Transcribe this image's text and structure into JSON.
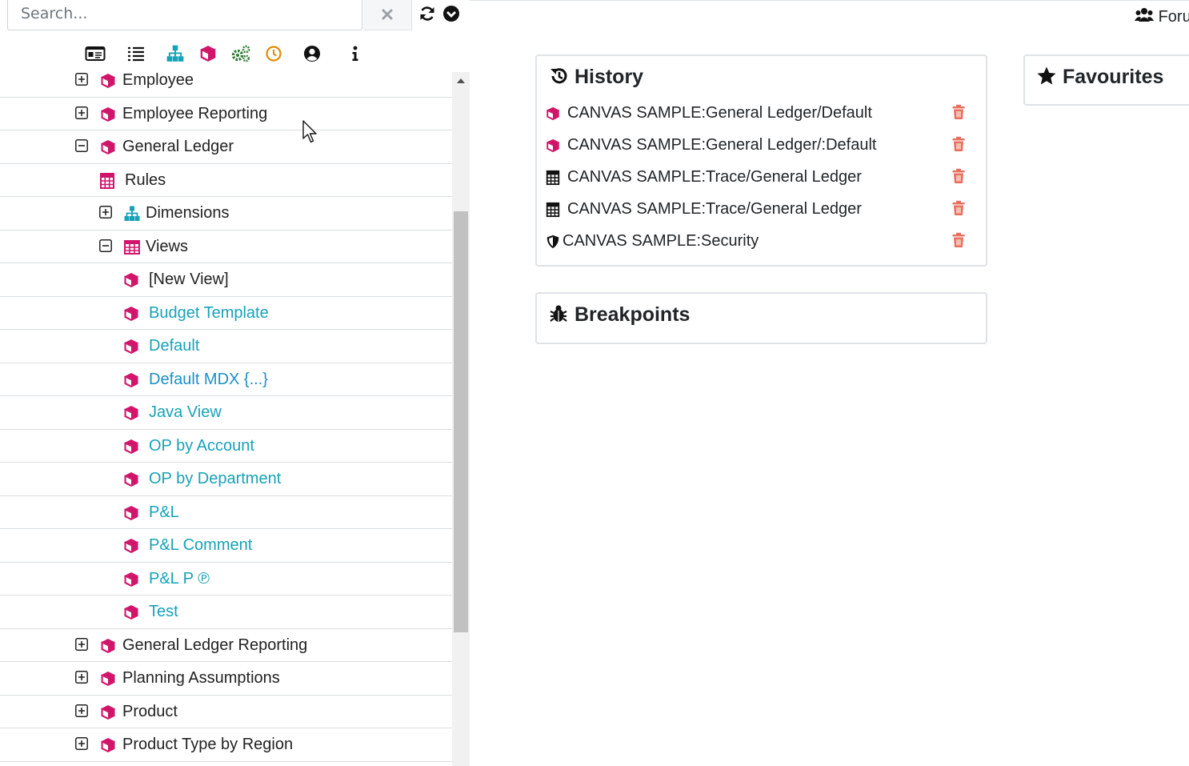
{
  "search": {
    "placeholder": "Search..."
  },
  "colors": {
    "cube": "#d1156b",
    "link": "#17a2b8",
    "link_alt": "#1a8fc7",
    "trash": "#e8705e",
    "hierarchy": "#17a2b8",
    "gears": "#2e7d32",
    "clock": "#e08a00"
  },
  "toolbar_icons": [
    "id-card-icon",
    "list-icon",
    "hierarchy-icon",
    "cube-icon",
    "gears-icon",
    "clock-icon",
    "user-circle-icon",
    "info-icon"
  ],
  "tree": [
    {
      "label": "Employee",
      "level": 0,
      "toggle": "plus",
      "icon": "cube",
      "style": "dark"
    },
    {
      "label": "Employee Reporting",
      "level": 0,
      "toggle": "plus",
      "icon": "cube",
      "style": "dark"
    },
    {
      "label": "General Ledger",
      "level": 0,
      "toggle": "minus",
      "icon": "cube",
      "style": "dark"
    },
    {
      "label": "Rules",
      "level": 1,
      "toggle": "none",
      "icon": "calculator",
      "style": "dark"
    },
    {
      "label": "Dimensions",
      "level": 1,
      "toggle": "plus",
      "icon": "hierarchy",
      "style": "dark"
    },
    {
      "label": "Views",
      "level": 1,
      "toggle": "minus",
      "icon": "table",
      "style": "dark"
    },
    {
      "label": "[New View]",
      "level": 2,
      "toggle": "none",
      "icon": "cube",
      "style": "dark"
    },
    {
      "label": "Budget Template",
      "level": 2,
      "toggle": "none",
      "icon": "cube",
      "style": "link"
    },
    {
      "label": "Default",
      "level": 2,
      "toggle": "none",
      "icon": "cube",
      "style": "link"
    },
    {
      "label": "Default MDX {...}",
      "level": 2,
      "toggle": "none",
      "icon": "cube",
      "style": "link2"
    },
    {
      "label": "Java View",
      "level": 2,
      "toggle": "none",
      "icon": "cube",
      "style": "link"
    },
    {
      "label": "OP by Account",
      "level": 2,
      "toggle": "none",
      "icon": "cube",
      "style": "link"
    },
    {
      "label": "OP by Department",
      "level": 2,
      "toggle": "none",
      "icon": "cube",
      "style": "link"
    },
    {
      "label": "P&L",
      "level": 2,
      "toggle": "none",
      "icon": "cube",
      "style": "link"
    },
    {
      "label": "P&L Comment",
      "level": 2,
      "toggle": "none",
      "icon": "cube",
      "style": "link"
    },
    {
      "label": "P&L P ℗",
      "level": 2,
      "toggle": "none",
      "icon": "cube",
      "style": "link"
    },
    {
      "label": "Test",
      "level": 2,
      "toggle": "none",
      "icon": "cube",
      "style": "link"
    },
    {
      "label": "General Ledger Reporting",
      "level": 0,
      "toggle": "plus",
      "icon": "cube",
      "style": "dark"
    },
    {
      "label": "Planning Assumptions",
      "level": 0,
      "toggle": "plus",
      "icon": "cube",
      "style": "dark"
    },
    {
      "label": "Product",
      "level": 0,
      "toggle": "plus",
      "icon": "cube",
      "style": "dark"
    },
    {
      "label": "Product Type by Region",
      "level": 0,
      "toggle": "plus",
      "icon": "cube",
      "style": "dark"
    }
  ],
  "history": {
    "title": "History",
    "items": [
      {
        "label": "CANVAS SAMPLE:General Ledger/Default",
        "icon": "cube"
      },
      {
        "label": "CANVAS SAMPLE:General Ledger/:Default",
        "icon": "cube"
      },
      {
        "label": "CANVAS SAMPLE:Trace/General Ledger",
        "icon": "calculator"
      },
      {
        "label": "CANVAS SAMPLE:Trace/General Ledger",
        "icon": "calculator"
      },
      {
        "label": "CANVAS SAMPLE:Security",
        "icon": "shield"
      }
    ]
  },
  "breakpoints": {
    "title": "Breakpoints"
  },
  "favourites": {
    "title": "Favourites"
  },
  "forum": {
    "label": "Foru"
  }
}
